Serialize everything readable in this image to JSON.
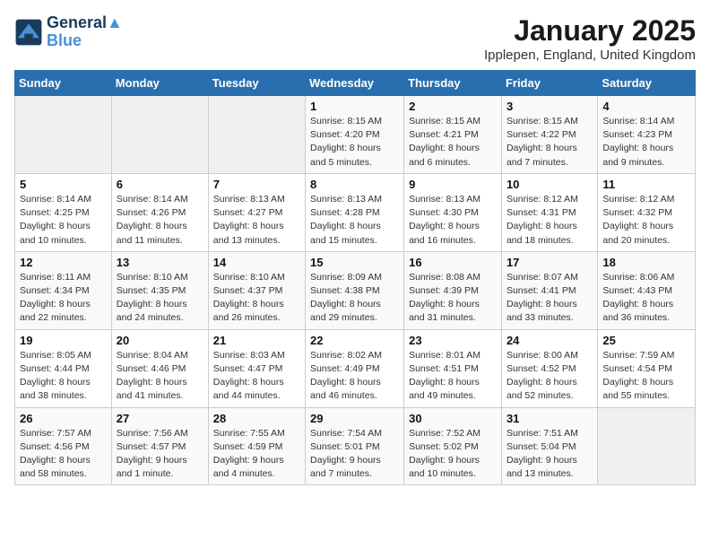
{
  "header": {
    "logo_line1": "General",
    "logo_line2": "Blue",
    "month": "January 2025",
    "location": "Ipplepen, England, United Kingdom"
  },
  "weekdays": [
    "Sunday",
    "Monday",
    "Tuesday",
    "Wednesday",
    "Thursday",
    "Friday",
    "Saturday"
  ],
  "weeks": [
    [
      {
        "day": "",
        "info": ""
      },
      {
        "day": "",
        "info": ""
      },
      {
        "day": "",
        "info": ""
      },
      {
        "day": "1",
        "info": "Sunrise: 8:15 AM\nSunset: 4:20 PM\nDaylight: 8 hours and 5 minutes."
      },
      {
        "day": "2",
        "info": "Sunrise: 8:15 AM\nSunset: 4:21 PM\nDaylight: 8 hours and 6 minutes."
      },
      {
        "day": "3",
        "info": "Sunrise: 8:15 AM\nSunset: 4:22 PM\nDaylight: 8 hours and 7 minutes."
      },
      {
        "day": "4",
        "info": "Sunrise: 8:14 AM\nSunset: 4:23 PM\nDaylight: 8 hours and 9 minutes."
      }
    ],
    [
      {
        "day": "5",
        "info": "Sunrise: 8:14 AM\nSunset: 4:25 PM\nDaylight: 8 hours and 10 minutes."
      },
      {
        "day": "6",
        "info": "Sunrise: 8:14 AM\nSunset: 4:26 PM\nDaylight: 8 hours and 11 minutes."
      },
      {
        "day": "7",
        "info": "Sunrise: 8:13 AM\nSunset: 4:27 PM\nDaylight: 8 hours and 13 minutes."
      },
      {
        "day": "8",
        "info": "Sunrise: 8:13 AM\nSunset: 4:28 PM\nDaylight: 8 hours and 15 minutes."
      },
      {
        "day": "9",
        "info": "Sunrise: 8:13 AM\nSunset: 4:30 PM\nDaylight: 8 hours and 16 minutes."
      },
      {
        "day": "10",
        "info": "Sunrise: 8:12 AM\nSunset: 4:31 PM\nDaylight: 8 hours and 18 minutes."
      },
      {
        "day": "11",
        "info": "Sunrise: 8:12 AM\nSunset: 4:32 PM\nDaylight: 8 hours and 20 minutes."
      }
    ],
    [
      {
        "day": "12",
        "info": "Sunrise: 8:11 AM\nSunset: 4:34 PM\nDaylight: 8 hours and 22 minutes."
      },
      {
        "day": "13",
        "info": "Sunrise: 8:10 AM\nSunset: 4:35 PM\nDaylight: 8 hours and 24 minutes."
      },
      {
        "day": "14",
        "info": "Sunrise: 8:10 AM\nSunset: 4:37 PM\nDaylight: 8 hours and 26 minutes."
      },
      {
        "day": "15",
        "info": "Sunrise: 8:09 AM\nSunset: 4:38 PM\nDaylight: 8 hours and 29 minutes."
      },
      {
        "day": "16",
        "info": "Sunrise: 8:08 AM\nSunset: 4:39 PM\nDaylight: 8 hours and 31 minutes."
      },
      {
        "day": "17",
        "info": "Sunrise: 8:07 AM\nSunset: 4:41 PM\nDaylight: 8 hours and 33 minutes."
      },
      {
        "day": "18",
        "info": "Sunrise: 8:06 AM\nSunset: 4:43 PM\nDaylight: 8 hours and 36 minutes."
      }
    ],
    [
      {
        "day": "19",
        "info": "Sunrise: 8:05 AM\nSunset: 4:44 PM\nDaylight: 8 hours and 38 minutes."
      },
      {
        "day": "20",
        "info": "Sunrise: 8:04 AM\nSunset: 4:46 PM\nDaylight: 8 hours and 41 minutes."
      },
      {
        "day": "21",
        "info": "Sunrise: 8:03 AM\nSunset: 4:47 PM\nDaylight: 8 hours and 44 minutes."
      },
      {
        "day": "22",
        "info": "Sunrise: 8:02 AM\nSunset: 4:49 PM\nDaylight: 8 hours and 46 minutes."
      },
      {
        "day": "23",
        "info": "Sunrise: 8:01 AM\nSunset: 4:51 PM\nDaylight: 8 hours and 49 minutes."
      },
      {
        "day": "24",
        "info": "Sunrise: 8:00 AM\nSunset: 4:52 PM\nDaylight: 8 hours and 52 minutes."
      },
      {
        "day": "25",
        "info": "Sunrise: 7:59 AM\nSunset: 4:54 PM\nDaylight: 8 hours and 55 minutes."
      }
    ],
    [
      {
        "day": "26",
        "info": "Sunrise: 7:57 AM\nSunset: 4:56 PM\nDaylight: 8 hours and 58 minutes."
      },
      {
        "day": "27",
        "info": "Sunrise: 7:56 AM\nSunset: 4:57 PM\nDaylight: 9 hours and 1 minute."
      },
      {
        "day": "28",
        "info": "Sunrise: 7:55 AM\nSunset: 4:59 PM\nDaylight: 9 hours and 4 minutes."
      },
      {
        "day": "29",
        "info": "Sunrise: 7:54 AM\nSunset: 5:01 PM\nDaylight: 9 hours and 7 minutes."
      },
      {
        "day": "30",
        "info": "Sunrise: 7:52 AM\nSunset: 5:02 PM\nDaylight: 9 hours and 10 minutes."
      },
      {
        "day": "31",
        "info": "Sunrise: 7:51 AM\nSunset: 5:04 PM\nDaylight: 9 hours and 13 minutes."
      },
      {
        "day": "",
        "info": ""
      }
    ]
  ]
}
